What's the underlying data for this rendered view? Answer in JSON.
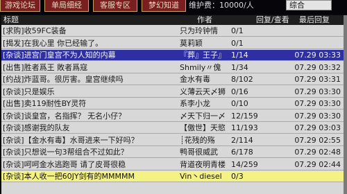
{
  "topbar": {
    "tabs": [
      "游戏论坛",
      "单局细经",
      "客服专区",
      "梦幻知道"
    ],
    "maintenance": "维护费：10000/人",
    "dropdown_value": "综合"
  },
  "columns": {
    "title": "标题",
    "author": "作者",
    "replies": "回复/查看",
    "last_reply": "最后回复"
  },
  "rows": [
    {
      "title": "[求购]收59FC装备",
      "author": "只为玲钟情",
      "count": "0/1",
      "time": "",
      "hl": ""
    },
    {
      "title": "[揭发]在我心里 你已经输了。",
      "author": "莫莉颖",
      "count": "0/1",
      "time": "",
      "hl": ""
    },
    {
      "title": "[杂谈]进宫门皇宫不为人知的内幕",
      "author": "『葬』王子』",
      "count": "1/14",
      "time": "07.29 03:33",
      "hl": "blue"
    },
    {
      "title": "[出售]胜者爲王 敗者爲寇",
      "author": "Shmily〃傀",
      "count": "1/34",
      "time": "07.29 03:32",
      "hl": ""
    },
    {
      "title": "[约战]炸蓝哥。很厉害。皇宫继续吗",
      "author": "金水有毒",
      "count": "8/102",
      "time": "07.29 03:31",
      "hl": ""
    },
    {
      "title": "[杂谈]只是娱乐",
      "author": "义薄云天〆狮",
      "count": "0/16",
      "time": "07.29 03:30",
      "hl": ""
    },
    {
      "title": "[出售]卖119耐性BY灵符",
      "author": "系李小龙",
      "count": "0/10",
      "time": "07.29 03:30",
      "hl": ""
    },
    {
      "title": "[杂谈]谈皇宫，名指挥？ 无名小仔？",
      "author": "〆天下归一〆",
      "count": "12/159",
      "time": "07.29 03:30",
      "hl": ""
    },
    {
      "title": "[杂谈]感谢我的队友",
      "author": "【傲世】天慾",
      "count": "11/193",
      "time": "07.29 03:03",
      "hl": ""
    },
    {
      "title": "[杂谈]【金水有毒】水哥进来一下好吗？",
      "author": "┊花残的殇",
      "count": "2/114",
      "time": "07.29 02:55",
      "hl": ""
    },
    {
      "title": "[杂谈]只想说一句3帮组合不过如此？",
      "author": "鸭哥很威武",
      "count": "6/178",
      "time": "07.29 02:48",
      "hl": ""
    },
    {
      "title": "[杂谈]呵呵金水逃跑哥 请了皮哥很稳",
      "author": "背道夜明青楼",
      "count": "14/259",
      "time": "07.29 02:44",
      "hl": ""
    },
    {
      "title": "[杂谈]本人收一把60JY剑有的MMMMM",
      "author": "Vin丶diesel",
      "count": "0/3",
      "time": "",
      "hl": "yellow"
    }
  ]
}
